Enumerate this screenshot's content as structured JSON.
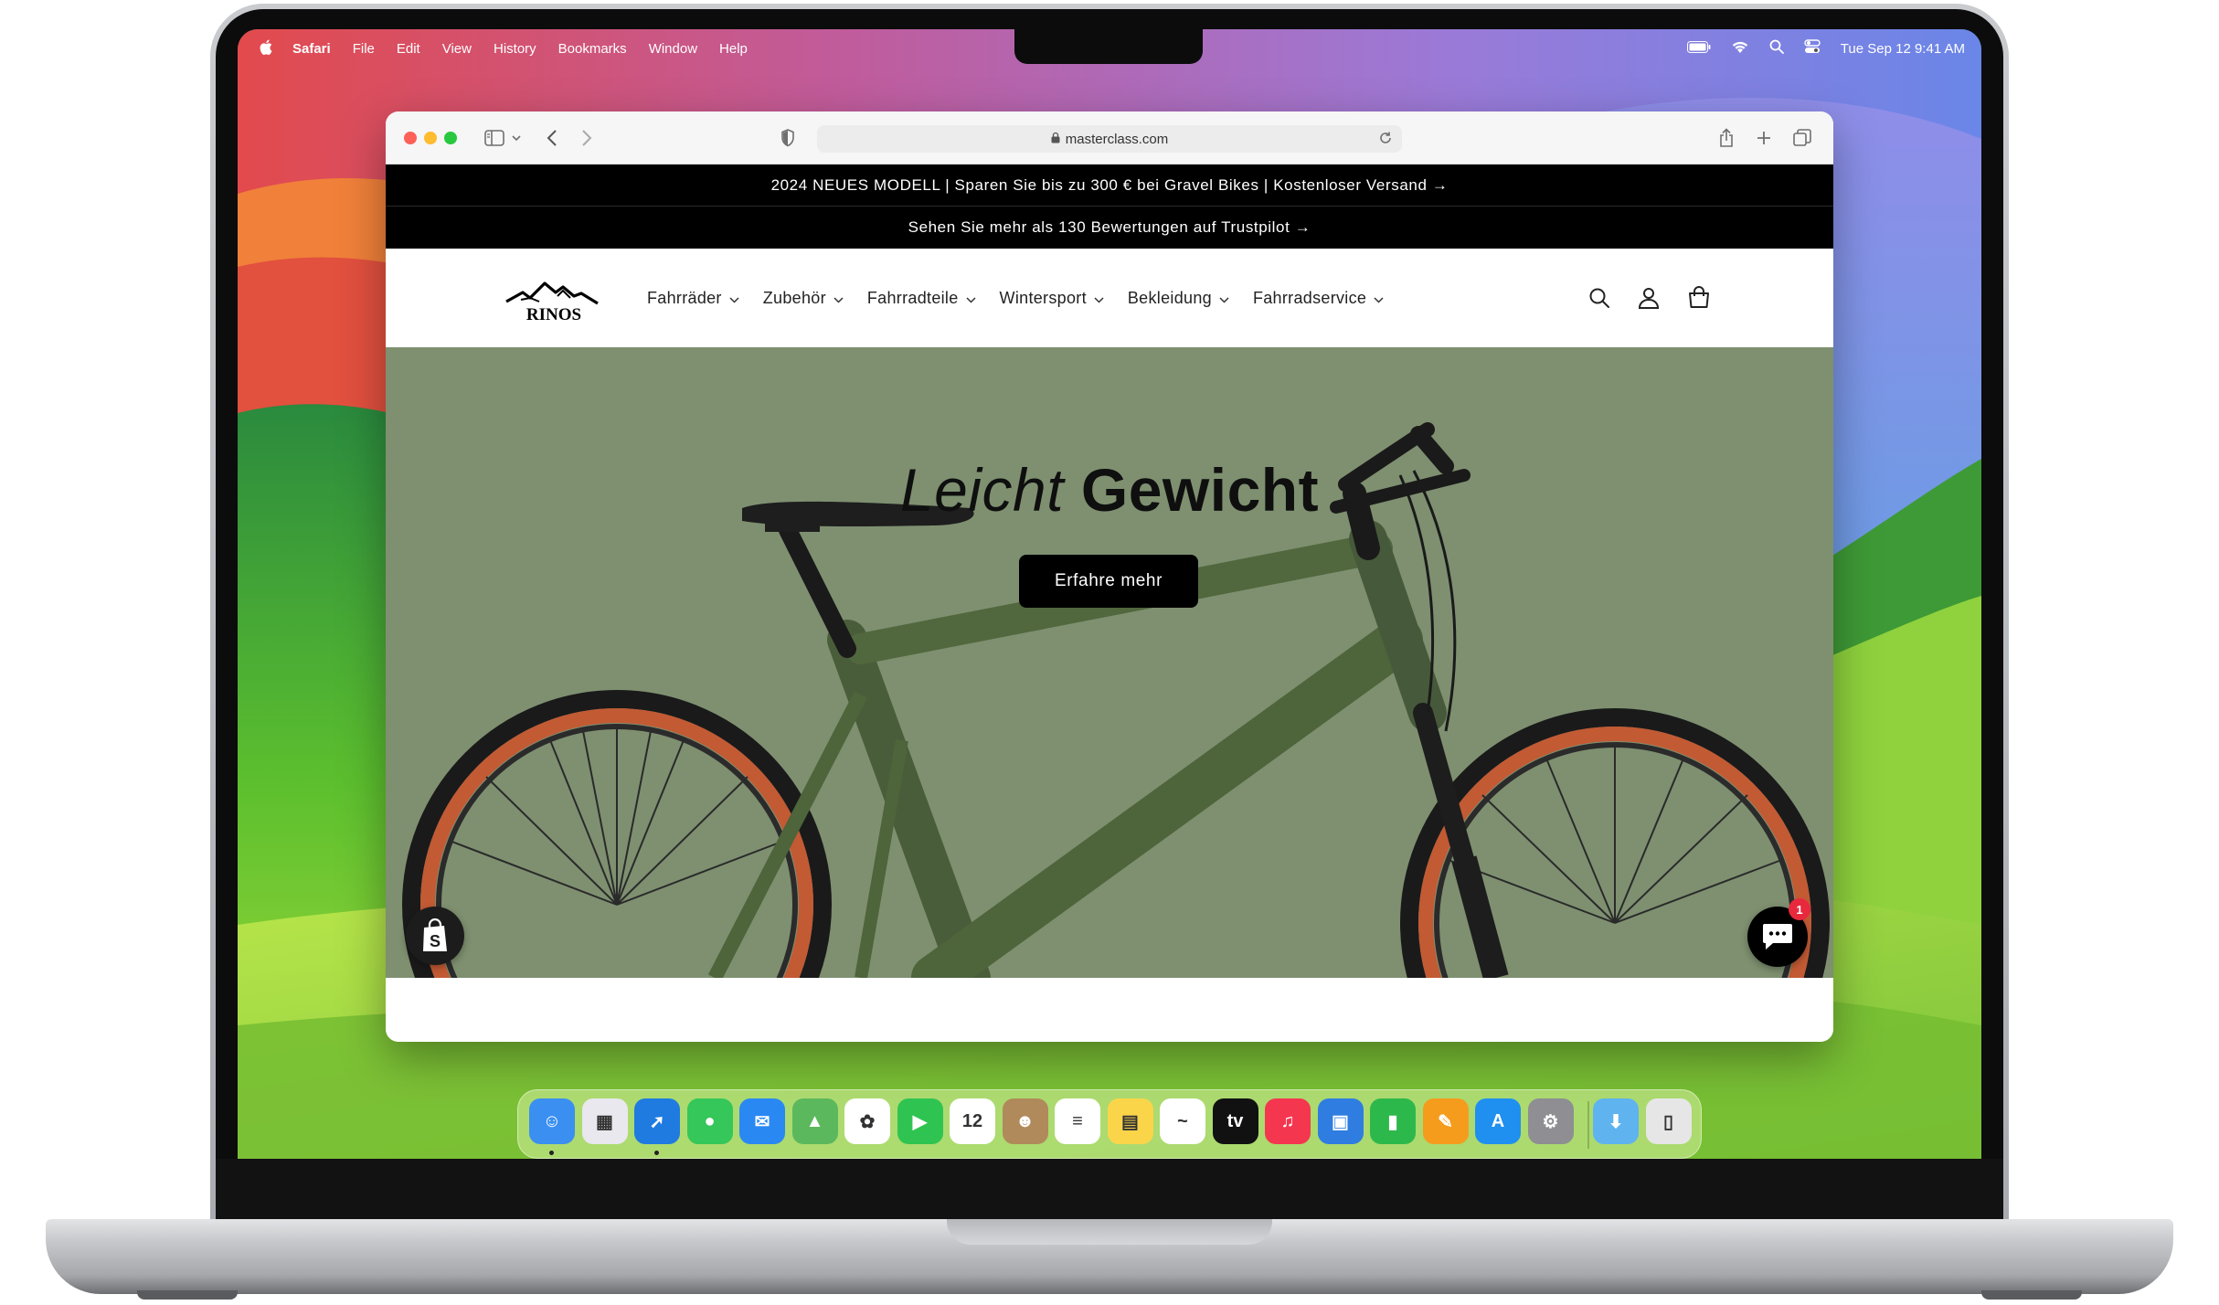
{
  "menubar": {
    "app_name": "Safari",
    "items": [
      "File",
      "Edit",
      "View",
      "History",
      "Bookmarks",
      "Window",
      "Help"
    ],
    "datetime": "Tue Sep 12  9:41 AM",
    "status_icons": [
      "battery-icon",
      "wifi-icon",
      "spotlight-icon",
      "control-center-icon"
    ]
  },
  "safari": {
    "url": "masterclass.com",
    "toolbar_icons": [
      "sidebar-icon",
      "chevron-down-icon",
      "back-icon",
      "forward-icon",
      "privacy-shield-icon",
      "reload-icon",
      "share-icon",
      "new-tab-icon",
      "tab-overview-icon"
    ]
  },
  "site": {
    "announcement_1": "2024 NEUES MODELL | Sparen Sie bis zu 300 € bei Gravel Bikes | Kostenloser Versand →",
    "announcement_2": "Sehen Sie mehr als 130 Bewertungen auf Trustpilot →",
    "logo_text": "RINOS",
    "nav": [
      "Fahrräder",
      "Zubehör",
      "Fahrradteile",
      "Wintersport",
      "Bekleidung",
      "Fahrradservice"
    ],
    "header_icons": [
      "search-icon",
      "account-icon",
      "cart-icon"
    ],
    "hero": {
      "title_light": "Leicht",
      "title_bold": "Gewicht",
      "cta": "Erfahre mehr",
      "background": "#7e9070"
    },
    "chat_badge": "1"
  },
  "dock": {
    "apps": [
      {
        "name": "finder",
        "color": "#3b8ff0",
        "glyph": "☺",
        "running": true
      },
      {
        "name": "launchpad",
        "color": "#e8e8ee",
        "glyph": "▦",
        "running": false
      },
      {
        "name": "safari",
        "color": "#1f7be0",
        "glyph": "➚",
        "running": true
      },
      {
        "name": "messages",
        "color": "#35c759",
        "glyph": "●",
        "running": false
      },
      {
        "name": "mail",
        "color": "#2a88f3",
        "glyph": "✉",
        "running": false
      },
      {
        "name": "maps",
        "color": "#5cb85c",
        "glyph": "▲",
        "running": false
      },
      {
        "name": "photos",
        "color": "#ffffff",
        "glyph": "✿",
        "running": false
      },
      {
        "name": "facetime",
        "color": "#2fc452",
        "glyph": "▶",
        "running": false
      },
      {
        "name": "calendar",
        "color": "#ffffff",
        "glyph": "12",
        "running": false
      },
      {
        "name": "contacts",
        "color": "#b08a5a",
        "glyph": "☻",
        "running": false
      },
      {
        "name": "reminders",
        "color": "#ffffff",
        "glyph": "≡",
        "running": false
      },
      {
        "name": "notes",
        "color": "#fad54a",
        "glyph": "▤",
        "running": false
      },
      {
        "name": "freeform",
        "color": "#ffffff",
        "glyph": "~",
        "running": false
      },
      {
        "name": "apple-tv",
        "color": "#111111",
        "glyph": "tv",
        "running": false
      },
      {
        "name": "music",
        "color": "#f5364f",
        "glyph": "♫",
        "running": false
      },
      {
        "name": "keynote",
        "color": "#2f7de1",
        "glyph": "▣",
        "running": false
      },
      {
        "name": "numbers",
        "color": "#2db84b",
        "glyph": "▮",
        "running": false
      },
      {
        "name": "pages",
        "color": "#f59c1d",
        "glyph": "✎",
        "running": false
      },
      {
        "name": "app-store",
        "color": "#1f8ff0",
        "glyph": "A",
        "running": false
      },
      {
        "name": "system-settings",
        "color": "#8e8e93",
        "glyph": "⚙",
        "running": false
      },
      {
        "name": "downloads-folder",
        "color": "#5fb3ef",
        "glyph": "⬇",
        "running": false
      },
      {
        "name": "trash",
        "color": "#e6e6e6",
        "glyph": "▯",
        "running": false
      }
    ]
  }
}
